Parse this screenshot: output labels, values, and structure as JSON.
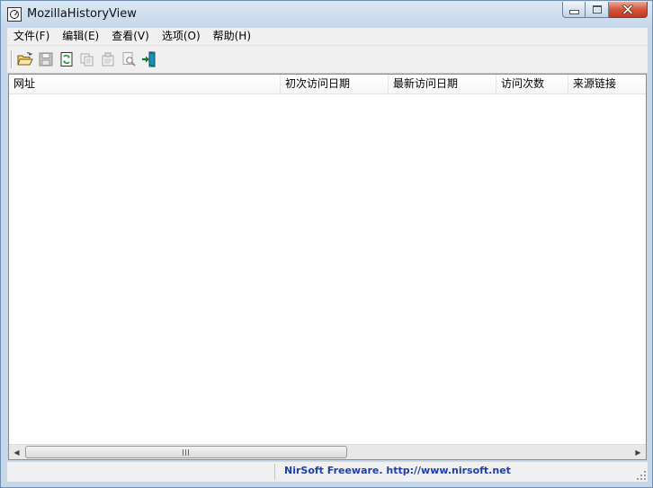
{
  "window": {
    "title": "MozillaHistoryView"
  },
  "menu": [
    {
      "label": "文件(F)"
    },
    {
      "label": "编辑(E)"
    },
    {
      "label": "查看(V)"
    },
    {
      "label": "选项(O)"
    },
    {
      "label": "帮助(H)"
    }
  ],
  "toolbar": {
    "buttons": [
      {
        "icon": "open-folder-icon"
      },
      {
        "icon": "save-disk-icon"
      },
      {
        "icon": "refresh-icon"
      },
      {
        "icon": "copy-icon"
      },
      {
        "icon": "properties-icon"
      },
      {
        "icon": "find-icon"
      },
      {
        "icon": "exit-door-icon"
      }
    ]
  },
  "list": {
    "columns": [
      {
        "label": "网址"
      },
      {
        "label": "初次访问日期"
      },
      {
        "label": "最新访问日期"
      },
      {
        "label": "访问次数"
      },
      {
        "label": "来源链接"
      }
    ],
    "rows": []
  },
  "statusbar": {
    "left_text": "",
    "link_text": "NirSoft Freeware.  http://www.nirsoft.net"
  },
  "colors": {
    "accent_link": "#1f3fae",
    "close_button": "#c0391f"
  }
}
